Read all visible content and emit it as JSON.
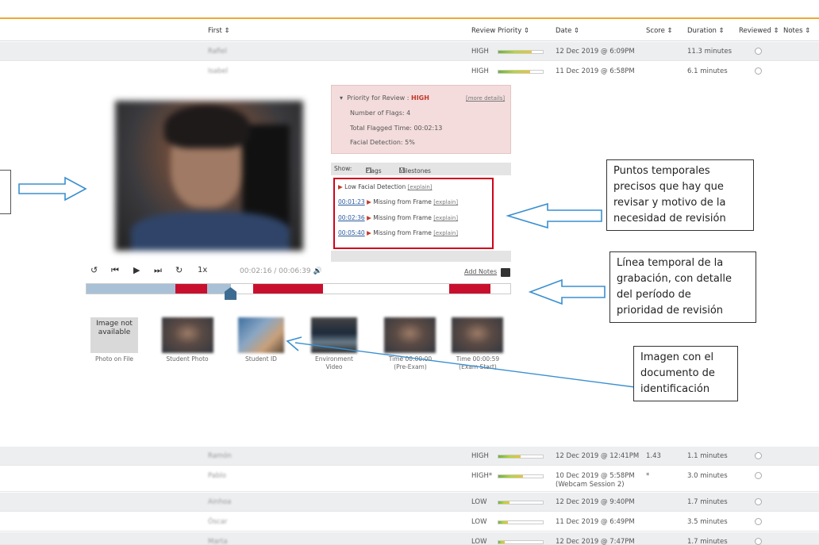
{
  "header": {
    "first": "First ⇕",
    "review_priority": "Review Priority ⇕",
    "date": "Date ⇕",
    "score": "Score ⇕",
    "duration": "Duration ⇕",
    "reviewed": "Reviewed ⇕",
    "notes": "Notes ⇕"
  },
  "rows_top": [
    {
      "name": "Rafiel",
      "priority": "HIGH",
      "priority_level": 0.75,
      "date": "12 Dec 2019 @ 6:09PM",
      "score": "",
      "duration": "11.3 minutes"
    },
    {
      "name": "Isabel",
      "priority": "HIGH",
      "priority_level": 0.72,
      "date": "11 Dec 2019 @ 6:58PM",
      "score": "",
      "duration": "6.1 minutes"
    }
  ],
  "rows_bottom": [
    {
      "name": "Ramón",
      "priority": "HIGH",
      "priority_level": 0.5,
      "date": "12 Dec 2019 @ 12:41PM",
      "date2": "",
      "score": "1.43",
      "duration": "1.1 minutes"
    },
    {
      "name": "Pablo",
      "priority": "HIGH*",
      "priority_level": 0.55,
      "date": "10 Dec 2019 @ 5:58PM",
      "date2": "(Webcam Session 2)",
      "score": "*",
      "duration": "3.0 minutes"
    },
    {
      "name": "Ainhoa",
      "priority": "LOW",
      "priority_level": 0.25,
      "date": "12 Dec 2019 @ 9:40PM",
      "date2": "",
      "score": "",
      "duration": "1.7 minutes"
    },
    {
      "name": "Óscar",
      "priority": "LOW",
      "priority_level": 0.22,
      "date": "11 Dec 2019 @ 6:49PM",
      "date2": "",
      "score": "",
      "duration": "3.5 minutes"
    },
    {
      "name": "Marta",
      "priority": "LOW",
      "priority_level": 0.15,
      "date": "12 Dec 2019 @ 7:47PM",
      "date2": "",
      "score": "",
      "duration": "1.7 minutes"
    }
  ],
  "panel": {
    "priority_label": "Priority for Review : ",
    "priority_value": "HIGH",
    "more_details": "[more details]",
    "flags": "Number of Flags: 4",
    "flagged_time": "Total Flagged Time: 00:02:13",
    "facial": "Facial Detection: 5%"
  },
  "show": {
    "label": "Show:",
    "flags": "Flags",
    "milestones": "Milestones"
  },
  "flag_items": [
    {
      "time": "",
      "text": "Low Facial Detection",
      "explain": "[explain]"
    },
    {
      "time": "00:01:23",
      "text": "Missing from Frame",
      "explain": "[explain]"
    },
    {
      "time": "00:02:36",
      "text": "Missing from Frame",
      "explain": "[explain]"
    },
    {
      "time": "00:05:40",
      "text": "Missing from Frame",
      "explain": "[explain]"
    }
  ],
  "player": {
    "speed": "1x",
    "timecode": "00:02:16 / 00:06:39",
    "add_notes": "Add Notes",
    "progress": 0.34
  },
  "thumbnails": [
    {
      "caption": "Photo on File",
      "caption2": "",
      "na_text": "Image not available"
    },
    {
      "caption": "Student Photo",
      "caption2": ""
    },
    {
      "caption": "Student ID",
      "caption2": ""
    },
    {
      "caption": "Environment",
      "caption2": "Video"
    },
    {
      "caption": "Time 00:00:00",
      "caption2": "(Pre-Exam)"
    },
    {
      "caption": "Time 00:00:59",
      "caption2": "(Exam Start)"
    }
  ],
  "callouts": {
    "c1": [
      "Puntos temporales",
      "precisos que hay que",
      "revisar y motivo de la",
      "necesidad de revisión"
    ],
    "c2": [
      "Línea temporal de la",
      "grabación, con detalle",
      "del período de",
      "prioridad de revisión"
    ],
    "c3": [
      "Imagen con el",
      "documento de",
      "identificación"
    ]
  },
  "colors": {
    "accent": "#f0a733",
    "flag_red": "#c8102e",
    "link_blue": "#2a5aa0",
    "arrow_blue": "#3a8fd0"
  }
}
